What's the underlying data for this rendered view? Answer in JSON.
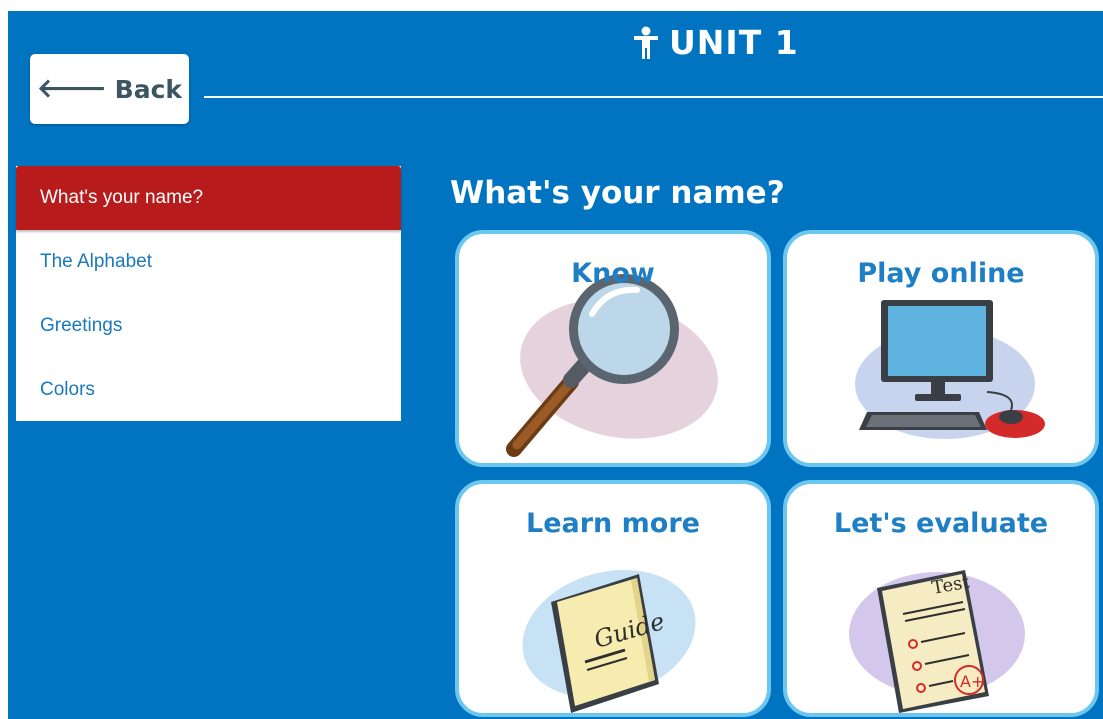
{
  "header": {
    "back_label": "Back",
    "title": "UNIT 1"
  },
  "sidebar": {
    "items": [
      {
        "label": "What's your name?",
        "active": true
      },
      {
        "label": "The Alphabet",
        "active": false
      },
      {
        "label": "Greetings",
        "active": false
      },
      {
        "label": "Colors",
        "active": false
      }
    ]
  },
  "main": {
    "section_title": "What's your name?",
    "cards": [
      {
        "label": "Know",
        "icon": "magnifier-icon"
      },
      {
        "label": "Play online",
        "icon": "computer-icon"
      },
      {
        "label": "Learn more",
        "icon": "guide-book-icon"
      },
      {
        "label": "Let's evaluate",
        "icon": "test-paper-icon"
      }
    ],
    "guide_text": "Guide",
    "test_text": "Test",
    "grade_text": "A+"
  },
  "colors": {
    "background": "#0074c1",
    "active_item": "#b71b1b",
    "card_border": "#6cc6ee",
    "card_title": "#1f7fc4"
  }
}
